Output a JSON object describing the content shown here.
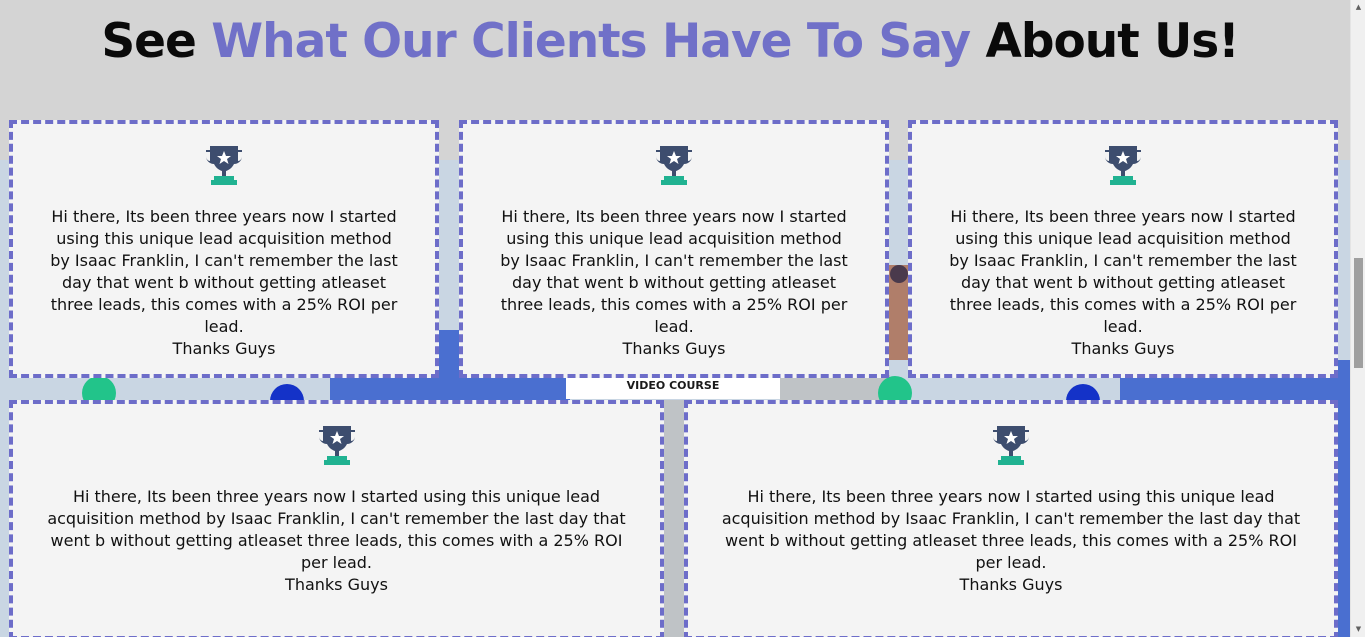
{
  "heading": {
    "part1": "See ",
    "accent": "What Our Clients Have To Say",
    "part2": " About Us!"
  },
  "background": {
    "video_label": "VIDEO COURSE"
  },
  "testimonials": [
    {
      "icon": "trophy-icon",
      "quote": "Hi there, Its been three years now I started using this unique lead acquisition method by Isaac Franklin, I can't remember the last day that went b without getting atleaset three leads, this comes with a 25% ROI per lead.",
      "signoff": "Thanks Guys"
    },
    {
      "icon": "trophy-icon",
      "quote": "Hi there, Its been three years now I started using this unique lead acquisition method by Isaac Franklin, I can't remember the last day that went b without getting atleaset three leads, this comes with a 25% ROI per lead.",
      "signoff": "Thanks Guys"
    },
    {
      "icon": "trophy-icon",
      "quote": "Hi there, Its been three years now I started using this unique lead acquisition method by Isaac Franklin, I can't remember the last day that went b without getting atleaset three leads, this comes with a 25% ROI per lead.",
      "signoff": "Thanks Guys"
    },
    {
      "icon": "trophy-icon",
      "quote": "Hi there, Its been three years now I started using this unique lead acquisition method by Isaac Franklin, I can't remember the last day that went b without getting atleaset three leads, this comes with a 25% ROI per lead.",
      "signoff": "Thanks Guys"
    },
    {
      "icon": "trophy-icon",
      "quote": "Hi there, Its been three years now I started using this unique lead acquisition method by Isaac Franklin, I can't remember the last day that went b without getting atleaset three leads, this comes with a 25% ROI per lead.",
      "signoff": "Thanks Guys"
    }
  ],
  "colors": {
    "accent": "#7070c8",
    "card_border": "#6d6dc9",
    "card_bg": "#f4f4f4",
    "page_bg": "#d4d4d4",
    "trophy_top": "#3d4d6e",
    "trophy_bottom": "#20b291"
  }
}
